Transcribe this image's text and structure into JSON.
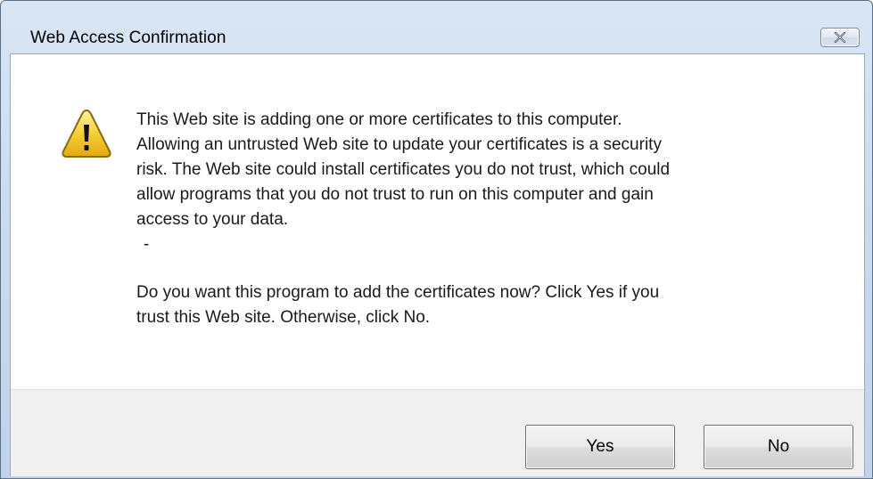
{
  "window": {
    "title": "Web Access Confirmation",
    "close_icon": "close-icon"
  },
  "dialog": {
    "icon": "warning-icon",
    "message_lines": [
      "This Web site is adding one or more certificates to this computer.",
      "Allowing an untrusted Web site to update your certificates is a security",
      "risk. The Web site could install certificates you do not trust, which could",
      "allow programs that you do not trust to run on this computer and gain",
      "access to your data."
    ],
    "dash": "-",
    "question_lines": [
      "Do you want this program to add the certificates now? Click Yes if you",
      "trust this Web site. Otherwise, click No."
    ]
  },
  "buttons": {
    "yes_label": "Yes",
    "no_label": "No"
  },
  "colors": {
    "titlebar": "#cbdcef",
    "footer": "#f0f0f0",
    "warning_yellow": "#f7d33c"
  }
}
